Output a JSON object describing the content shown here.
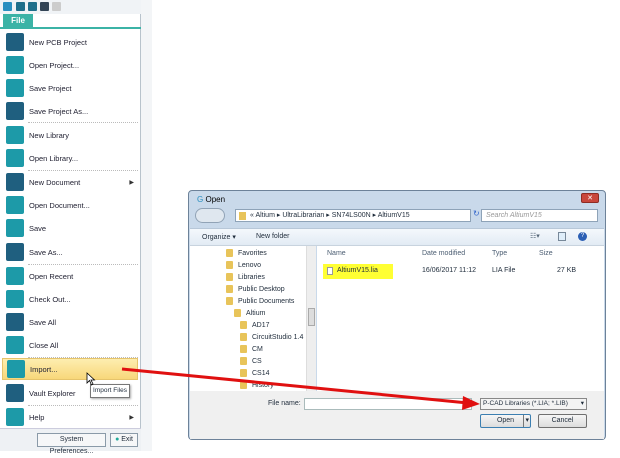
{
  "file_menu": {
    "tab_label": "File",
    "items": [
      {
        "label": "New PCB Project",
        "icon": "new-pcb-project-icon"
      },
      {
        "label": "Open Project...",
        "icon": "open-project-icon"
      },
      {
        "label": "Save Project",
        "icon": "save-project-icon"
      },
      {
        "label": "Save Project As...",
        "icon": "save-project-as-icon"
      },
      {
        "label": "New Library",
        "icon": "new-library-icon"
      },
      {
        "label": "Open Library...",
        "icon": "open-library-icon"
      },
      {
        "label": "New Document",
        "icon": "new-document-icon",
        "submenu": true
      },
      {
        "label": "Open Document...",
        "icon": "open-document-icon"
      },
      {
        "label": "Save",
        "icon": "save-icon"
      },
      {
        "label": "Save As...",
        "icon": "save-as-icon"
      },
      {
        "label": "Open Recent",
        "icon": "open-recent-icon"
      },
      {
        "label": "Check Out...",
        "icon": "check-out-icon"
      },
      {
        "label": "Save All",
        "icon": "save-all-icon"
      },
      {
        "label": "Close All",
        "icon": "close-all-icon"
      },
      {
        "label": "Import...",
        "icon": "import-icon",
        "highlighted": true
      },
      {
        "label": "Vault Explorer",
        "icon": "vault-explorer-icon"
      },
      {
        "label": "Help",
        "icon": "help-icon",
        "submenu": true
      }
    ],
    "system_preferences_label": "System Preferences...",
    "exit_label": "Exit",
    "tooltip": "Import Files"
  },
  "dialog": {
    "title": "Open",
    "breadcrumb": [
      "Altium",
      "UltraLibrarian",
      "SN74LS00N",
      "AltiumV15"
    ],
    "search_placeholder": "Search AltiumV15",
    "organize_label": "Organize ▾",
    "new_folder_label": "New folder",
    "tree": [
      "Favorites",
      "Lenovo",
      "Libraries",
      "Public Desktop",
      "Public Documents",
      "Altium",
      "AD17",
      "CircuitStudio 1.4",
      "CM",
      "CS",
      "CS14",
      "History"
    ],
    "columns": [
      "Name",
      "Date modified",
      "Type",
      "Size"
    ],
    "files": [
      {
        "name": "AltiumV15.lia",
        "date": "16/06/2017 11:12",
        "type": "LIA File",
        "size": "27 KB"
      }
    ],
    "file_name_label": "File name:",
    "file_name_value": "",
    "filter": "P-CAD Libraries (*.LIA; *.LIB)",
    "open_label": "Open",
    "cancel_label": "Cancel"
  },
  "colors": {
    "accent": "#3bb3a6",
    "highlight_file": "#ffff33",
    "arrow": "#e01010"
  }
}
